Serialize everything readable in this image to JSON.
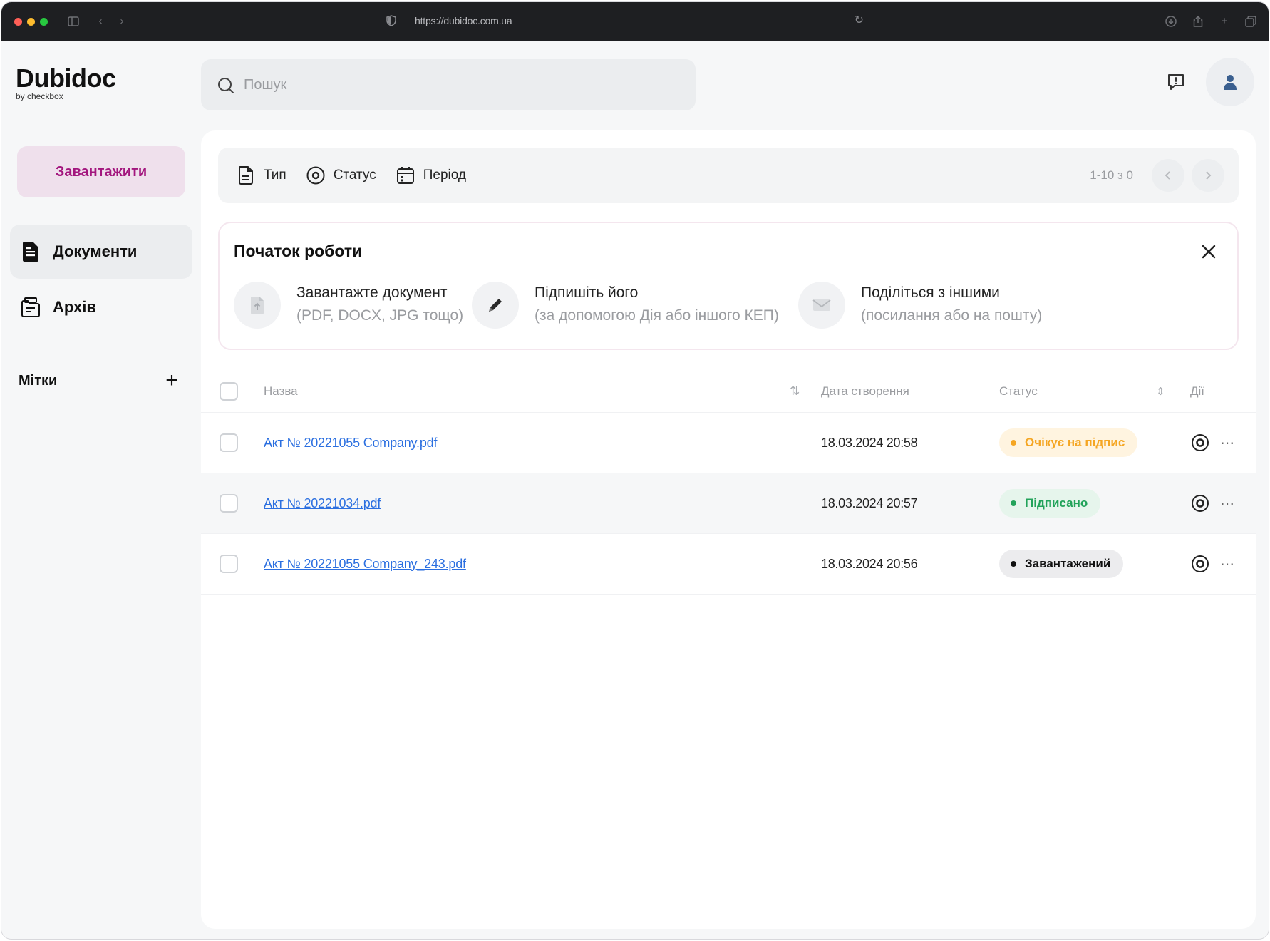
{
  "browser": {
    "url": "https://dubidoc.com.ua"
  },
  "logo": {
    "title": "Dubidoc",
    "subtitle": "by checkbox"
  },
  "search": {
    "placeholder": "Пошук"
  },
  "sidebar": {
    "upload_label": "Завантажити",
    "nav": [
      {
        "label": "Документи",
        "icon": "document-icon",
        "active": true
      },
      {
        "label": "Архів",
        "icon": "archive-icon",
        "active": false
      }
    ],
    "tags_title": "Мітки",
    "tags_add": "+"
  },
  "filters": {
    "items": [
      {
        "label": "Тип",
        "icon": "file-type-icon"
      },
      {
        "label": "Статус",
        "icon": "status-icon"
      },
      {
        "label": "Період",
        "icon": "calendar-icon"
      }
    ],
    "pager_text": "1-10 з 0"
  },
  "onboarding": {
    "title": "Початок роботи",
    "steps": [
      {
        "title": "Завантажте документ",
        "subtitle": "(PDF, DOCX, JPG тощо)",
        "icon": "upload-file-icon"
      },
      {
        "title": "Підпишіть його",
        "subtitle": "(за допомогою Дія або іншого КЕП)",
        "icon": "pen-icon"
      },
      {
        "title": "Поділіться з іншими",
        "subtitle": "(посилання або на пошту)",
        "icon": "mail-icon"
      }
    ]
  },
  "table": {
    "headers": {
      "name": "Назва",
      "date": "Дата створення",
      "status": "Статус",
      "actions": "Дії"
    },
    "rows": [
      {
        "name": "Акт № 20221055 Company.pdf",
        "date": "18.03.2024 20:58",
        "status": "Очікує на підпис",
        "status_color": "#f5a623",
        "status_bg": "#fff4e0"
      },
      {
        "name": "Акт № 20221034.pdf",
        "date": "18.03.2024 20:57",
        "status": "Підписано",
        "status_color": "#22a35a",
        "status_bg": "#e6f5ec"
      },
      {
        "name": "Акт № 20221055 Company_243.pdf",
        "date": "18.03.2024 20:56",
        "status": "Завантажений",
        "status_color": "#111111",
        "status_bg": "#ececee"
      }
    ]
  },
  "colors": {
    "accent": "#a3167e",
    "accent_bg": "#efe0ec",
    "link": "#2b6fe0"
  }
}
